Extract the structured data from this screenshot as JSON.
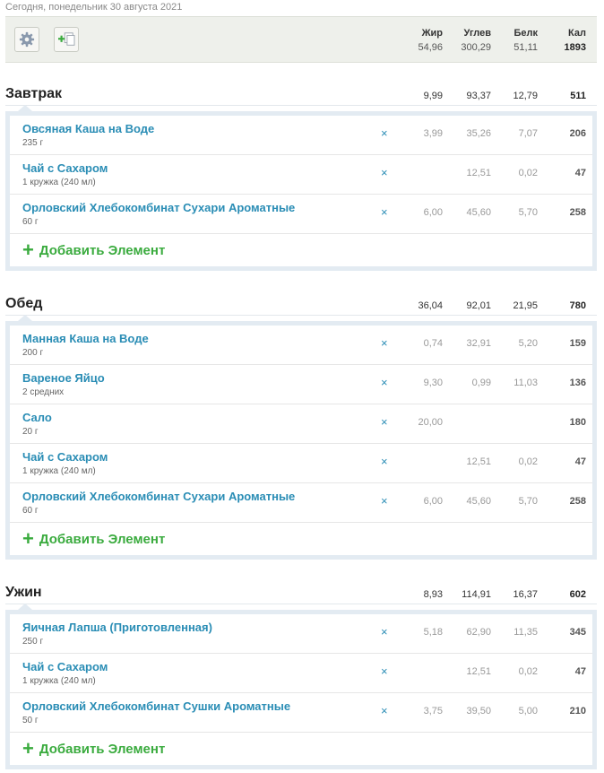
{
  "date_line": "Сегодня, понедельник 30 августа 2021",
  "toolbar": {
    "settings_icon": "gear-icon",
    "add_icon": "add-copy-icon"
  },
  "totals": {
    "headers": {
      "fat": "Жир",
      "carb": "Углев",
      "prot": "Белк",
      "kal": "Кал"
    },
    "fat": "54,96",
    "carb": "300,29",
    "prot": "51,11",
    "kal": "1893"
  },
  "add_label": "Добавить Элемент",
  "remove_symbol": "×",
  "meals": [
    {
      "name": "Завтрак",
      "fat": "9,99",
      "carb": "93,37",
      "prot": "12,79",
      "kal": "511",
      "items": [
        {
          "name": "Овсяная Каша на Воде",
          "qty": "235 г",
          "fat": "3,99",
          "carb": "35,26",
          "prot": "7,07",
          "kal": "206"
        },
        {
          "name": "Чай с Сахаром",
          "qty": "1 кружка (240 мл)",
          "fat": "",
          "carb": "12,51",
          "prot": "0,02",
          "kal": "47"
        },
        {
          "name": "Орловский Хлебокомбинат Сухари Ароматные",
          "qty": "60 г",
          "fat": "6,00",
          "carb": "45,60",
          "prot": "5,70",
          "kal": "258"
        }
      ]
    },
    {
      "name": "Обед",
      "fat": "36,04",
      "carb": "92,01",
      "prot": "21,95",
      "kal": "780",
      "items": [
        {
          "name": "Манная Каша на Воде",
          "qty": "200 г",
          "fat": "0,74",
          "carb": "32,91",
          "prot": "5,20",
          "kal": "159"
        },
        {
          "name": "Вареное Яйцо",
          "qty": "2 средних",
          "fat": "9,30",
          "carb": "0,99",
          "prot": "11,03",
          "kal": "136"
        },
        {
          "name": "Сало",
          "qty": "20 г",
          "fat": "20,00",
          "carb": "",
          "prot": "",
          "kal": "180"
        },
        {
          "name": "Чай с Сахаром",
          "qty": "1 кружка (240 мл)",
          "fat": "",
          "carb": "12,51",
          "prot": "0,02",
          "kal": "47"
        },
        {
          "name": "Орловский Хлебокомбинат Сухари Ароматные",
          "qty": "60 г",
          "fat": "6,00",
          "carb": "45,60",
          "prot": "5,70",
          "kal": "258"
        }
      ]
    },
    {
      "name": "Ужин",
      "fat": "8,93",
      "carb": "114,91",
      "prot": "16,37",
      "kal": "602",
      "items": [
        {
          "name": "Яичная Лапша (Приготовленная)",
          "qty": "250 г",
          "fat": "5,18",
          "carb": "62,90",
          "prot": "11,35",
          "kal": "345"
        },
        {
          "name": "Чай с Сахаром",
          "qty": "1 кружка (240 мл)",
          "fat": "",
          "carb": "12,51",
          "prot": "0,02",
          "kal": "47"
        },
        {
          "name": "Орловский Хлебокомбинат Сушки Ароматные",
          "qty": "50 г",
          "fat": "3,75",
          "carb": "39,50",
          "prot": "5,00",
          "kal": "210"
        }
      ]
    }
  ]
}
